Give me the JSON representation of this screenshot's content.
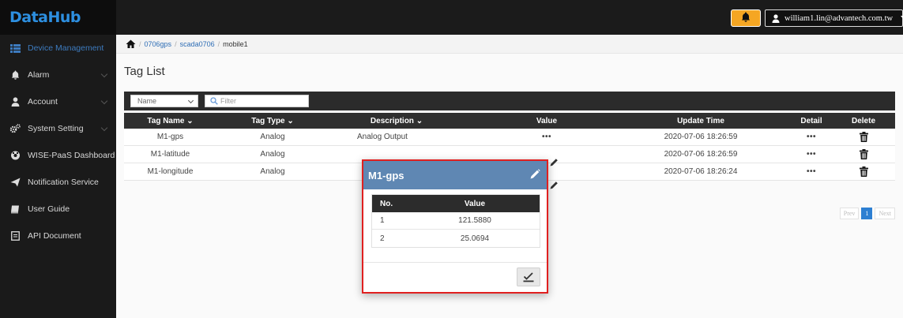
{
  "app": {
    "logo": "DataHub"
  },
  "header": {
    "user_email": "william1.lin@advantech.com.tw"
  },
  "sidebar": {
    "items": [
      {
        "label": "Device Management",
        "icon": "list-icon",
        "active": true
      },
      {
        "label": "Alarm",
        "icon": "bell-icon"
      },
      {
        "label": "Account",
        "icon": "user-icon"
      },
      {
        "label": "System Setting",
        "icon": "gears-icon"
      },
      {
        "label": "WISE-PaaS Dashboard",
        "icon": "dashboard-icon"
      },
      {
        "label": "Notification Service",
        "icon": "paper-plane-icon"
      },
      {
        "label": "User Guide",
        "icon": "book-icon"
      },
      {
        "label": "API Document",
        "icon": "document-icon"
      }
    ]
  },
  "breadcrumb": {
    "sep": "/",
    "crumb1": "0706gps",
    "crumb2": "scada0706",
    "current": "mobile1"
  },
  "page": {
    "title": "Tag List"
  },
  "filter": {
    "select_value": "Name",
    "placeholder": "Filter"
  },
  "table": {
    "headers": {
      "tag_name": "Tag Name ⌄",
      "tag_type": "Tag Type ⌄",
      "description": "Description ⌄",
      "value": "Value",
      "update_time": "Update Time",
      "detail": "Detail",
      "delete": "Delete"
    },
    "rows": [
      {
        "tag_name": "M1-gps",
        "tag_type": "Analog",
        "description": "Analog Output",
        "value": "•••",
        "update_time": "2020-07-06 18:26:59",
        "detail": "•••"
      },
      {
        "tag_name": "M1-latitude",
        "tag_type": "Analog",
        "description": "",
        "value": "",
        "update_time": "2020-07-06 18:26:59",
        "detail": "•••"
      },
      {
        "tag_name": "M1-longitude",
        "tag_type": "Analog",
        "description": "",
        "value": "",
        "update_time": "2020-07-06 18:26:24",
        "detail": "•••"
      }
    ]
  },
  "pagination": {
    "prev": "Prev",
    "current": "1",
    "next": "Next"
  },
  "modal": {
    "title": "M1-gps",
    "headers": {
      "no": "No.",
      "value": "Value"
    },
    "rows": [
      {
        "no": "1",
        "value": "121.5880"
      },
      {
        "no": "2",
        "value": "25.0694"
      }
    ]
  },
  "colors": {
    "brand_blue": "#2d8fe0",
    "modal_header": "#5f87b3",
    "highlight_border": "#e02020",
    "bell": "#f5a623"
  }
}
